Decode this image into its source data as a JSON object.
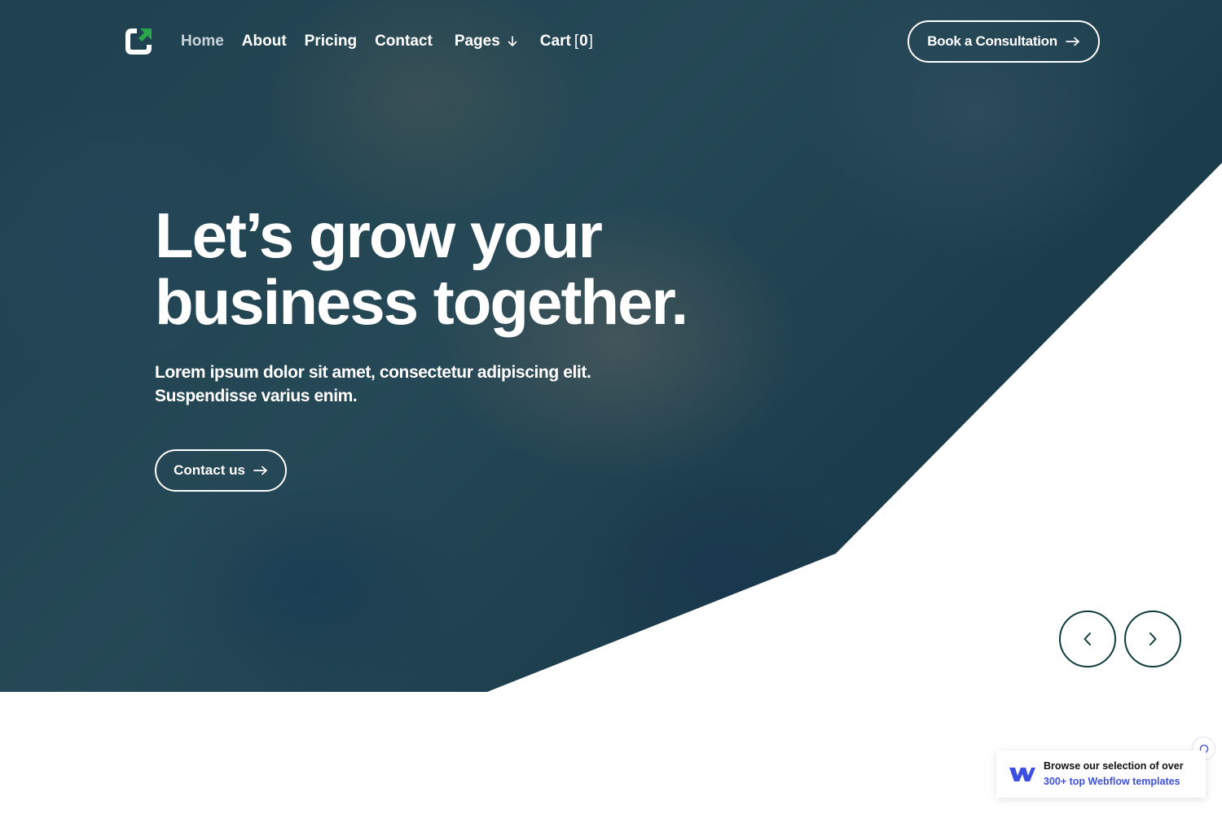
{
  "colors": {
    "overlay": "#0c3a48",
    "accent_green": "#2aa64b",
    "white": "#ffffff",
    "dark_teal": "#0d3b3e",
    "webflow_blue": "#3d4fe0"
  },
  "header": {
    "logo_icon": "logo-arrow-icon",
    "nav": {
      "home": "Home",
      "about": "About",
      "pricing": "Pricing",
      "contact": "Contact",
      "pages": "Pages",
      "cart": "Cart",
      "cart_count": "0"
    },
    "cta_label": "Book a Consultation"
  },
  "hero": {
    "headline_line1": "Let’s grow your",
    "headline_line2": "business together.",
    "subtext_line1": "Lorem ipsum dolor sit amet, consectetur adipiscing elit.",
    "subtext_line2": "Suspendisse varius enim.",
    "button_label": "Contact us"
  },
  "slider": {
    "prev_icon": "chevron-left-icon",
    "next_icon": "chevron-right-icon"
  },
  "webflow_badge": {
    "line1": "Browse our selection of over",
    "line2": "300+ top Webflow templates",
    "icon": "webflow-logo-icon"
  }
}
